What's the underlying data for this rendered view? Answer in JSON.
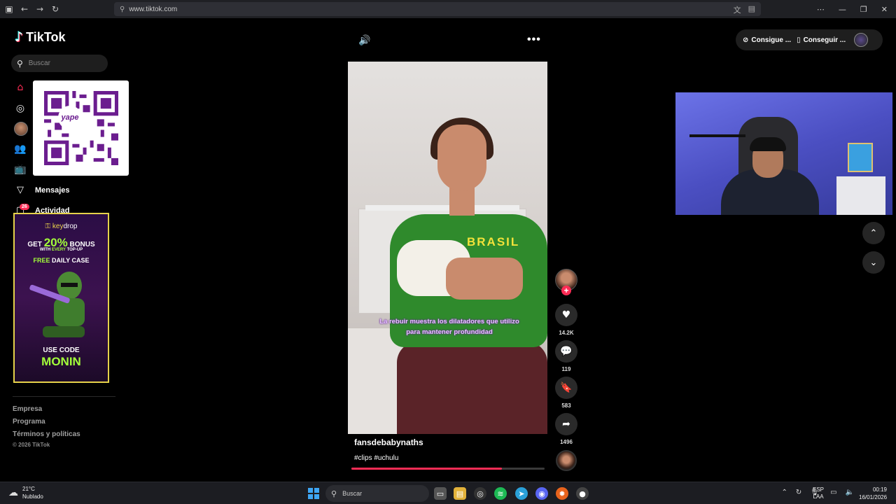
{
  "browser": {
    "url": "www.tiktok.com"
  },
  "sidebar": {
    "logo": "TikTok",
    "search_placeholder": "Buscar",
    "menu": {
      "messages": "Mensajes",
      "activity": "Actividad",
      "activity_badge": "26"
    },
    "footer": {
      "links": [
        "Empresa",
        "Programa",
        "Términos y políticas"
      ],
      "copyright": "© 2026 TikTok"
    }
  },
  "qr": {
    "center_label": "yape"
  },
  "ad": {
    "brand_prefix": "key",
    "brand_suffix": "drop",
    "line1_pre": "GET",
    "line1_big": "20%",
    "line1_post": "BONUS",
    "line2_pre": "WITH",
    "line2_mid": "EVERY",
    "line2_post": "TOP-UP",
    "line3_a": "FREE",
    "line3_b": "DAILY CASE",
    "use_code": "USE CODE",
    "code": "MONIN"
  },
  "video": {
    "caption": "La rebuir muestra los dilatadores que utilizo para mantener profundidad",
    "shirt_text": "BRASIL",
    "author": "fansdebabynaths",
    "hashtags": "#clips #uchulu",
    "progress_fraction": 0.78
  },
  "actions": {
    "likes": "14.2K",
    "comments": "119",
    "saves": "583",
    "shares": "1496"
  },
  "topbar": {
    "get_coins": "Consigue ...",
    "get_app": "Conseguir ..."
  },
  "taskbar": {
    "temperature": "21°C",
    "weather": "Nublado",
    "search": "Buscar",
    "lang_1": "ESP",
    "lang_2": "LAA",
    "time": "00:19",
    "date": "16/01/2026"
  },
  "colors": {
    "accent": "#fe2c55",
    "ad_green": "#a3ff3a",
    "qr_purple": "#6b1d8f"
  }
}
